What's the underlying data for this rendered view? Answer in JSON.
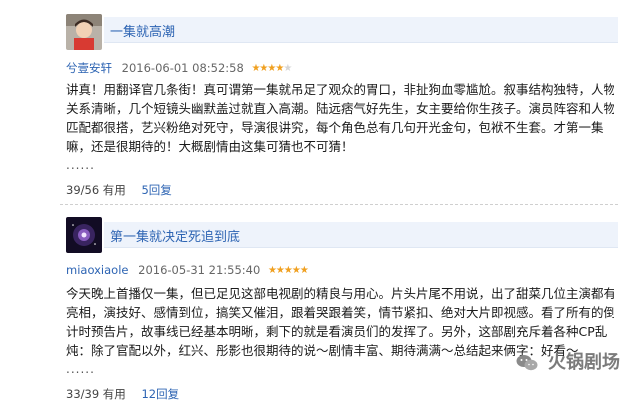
{
  "reviews": [
    {
      "title": "一集就高潮",
      "user": "兮壹安轩",
      "date": "2016-06-01 08:52:58",
      "rating": 4,
      "lines": [
        "讲真！用翻译官几条街！真可谓第一集就吊足了观众的胃口，非扯狗血零尴尬。叙事结构独特，人物",
        "关系清晰，几个短镜头幽默盖过就直入高潮。陆远痞气好先生，女主要给你生孩子。演员阵容和人物",
        "匹配都很搭，艺兴粉绝对死守，导演很讲究，每个角色总有几句开光金句，包袱不生套。才第一集",
        "嘛，还是很期待的！大概剧情由这集可猜也不可猜！"
      ],
      "ellipsis": "......",
      "useful": "39/56 有用",
      "reply": "5回复"
    },
    {
      "title": "第一集就决定死追到底",
      "user": "miaoxiaole",
      "date": "2016-05-31 21:55:40",
      "rating": 5,
      "lines": [
        "今天晚上首播仅一集，但已足见这部电视剧的精良与用心。片头片尾不用说，出了甜菜几位主演都有",
        "亮相，演技好、感情到位，搞笑又催泪，跟着哭跟着笑，情节紧扣、绝对大片即视感。看了所有的倒",
        "计时预告片，故事线已经基本明晰，剩下的就是看演员们的发挥了。另外，这部剧充斥着各种CP乱",
        "炖：除了官配以外，红兴、彤影也很期待的说～剧情丰富、期待满满～总结起来俩字：好看～"
      ],
      "ellipsis": "......",
      "useful": "33/39 有用",
      "reply": "12回复"
    }
  ],
  "watermark": "火锅剧场",
  "colors": {
    "link": "#2d64b3",
    "star": "#f0a020",
    "title_bg": "#eef3fb"
  }
}
